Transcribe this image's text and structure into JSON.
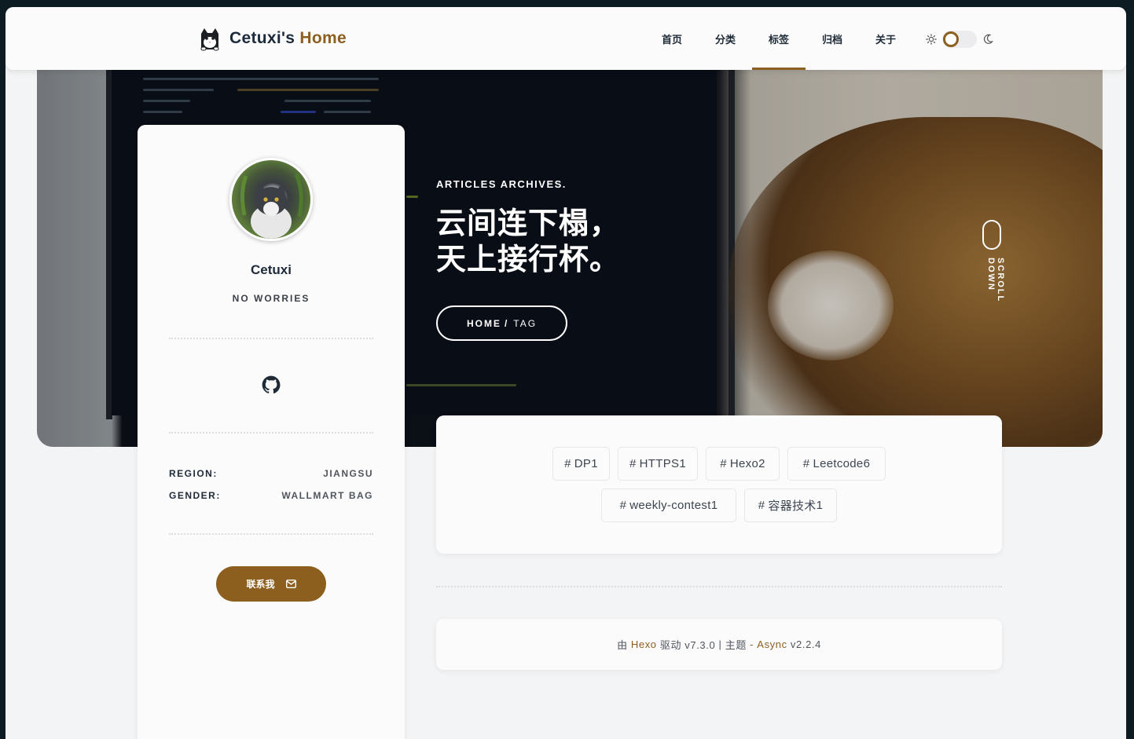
{
  "header": {
    "logo_name": "Cetuxi's",
    "logo_accent": "Home",
    "nav": [
      {
        "label": "首页",
        "active": false
      },
      {
        "label": "分类",
        "active": false
      },
      {
        "label": "标签",
        "active": true
      },
      {
        "label": "归档",
        "active": false
      },
      {
        "label": "关于",
        "active": false
      }
    ],
    "theme": {
      "sun_icon": "sun-icon",
      "moon_icon": "moon-icon",
      "mode": "light"
    }
  },
  "hero": {
    "subtitle": "ARTICLES ARCHIVES.",
    "title_line1": "云间连下榻，",
    "title_line2": "天上接行杯。",
    "breadcrumb_home": "HOME",
    "breadcrumb_sep": "/",
    "breadcrumb_current": "TAG",
    "scroll_text": "SCROLL DOWN"
  },
  "profile": {
    "name": "Cetuxi",
    "motto": "NO WORRIES",
    "social_icon": "github-icon",
    "info": [
      {
        "label": "REGION:",
        "value": "JIANGSU"
      },
      {
        "label": "GENDER:",
        "value": "WALLMART BAG"
      }
    ],
    "contact_label": "联系我"
  },
  "tags": [
    {
      "name": "DP",
      "count": "1"
    },
    {
      "name": "HTTPS",
      "count": "1"
    },
    {
      "name": "Hexo",
      "count": "2"
    },
    {
      "name": "Leetcode",
      "count": "6"
    },
    {
      "name": "weekly-contest",
      "count": "1"
    },
    {
      "name": "容器技术",
      "count": "1"
    }
  ],
  "footer": {
    "prefix": "由",
    "hexo": "Hexo",
    "driven": "驱动 v7.3.0",
    "sep": "|",
    "theme_label": "主题",
    "dash": "-",
    "async": "Async",
    "async_version": "v2.2.4"
  },
  "colors": {
    "accent": "#8c5f1f",
    "page_bg": "#0d1b22",
    "card_bg": "#fbfbfc"
  }
}
